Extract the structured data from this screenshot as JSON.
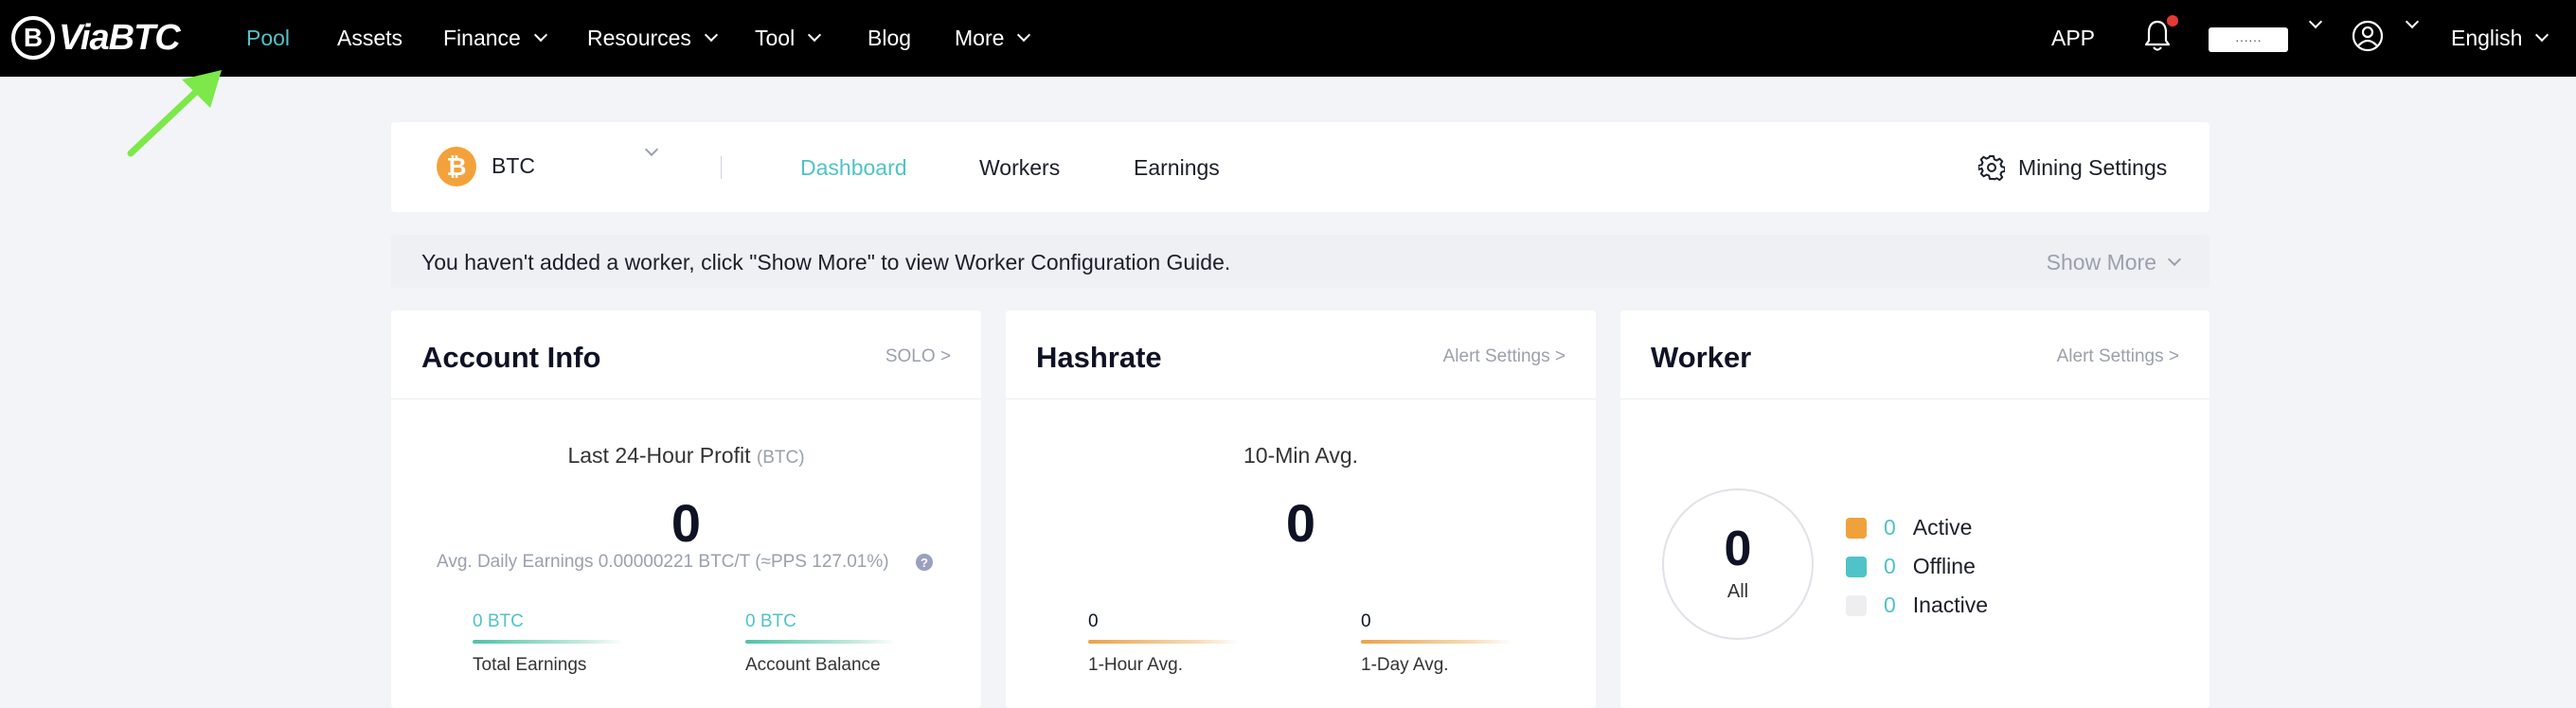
{
  "brand": {
    "name": "ViaBTC",
    "mark": "B"
  },
  "nav": {
    "pool": "Pool",
    "assets": "Assets",
    "finance": "Finance",
    "resources": "Resources",
    "tool": "Tool",
    "blog": "Blog",
    "more": "More",
    "app": "APP",
    "language": "English",
    "username": "······"
  },
  "tabs": {
    "coin": "BTC",
    "coin_symbol": "₿",
    "dashboard": "Dashboard",
    "workers": "Workers",
    "earnings": "Earnings",
    "mining_settings": "Mining Settings"
  },
  "notice": {
    "text": "You haven't added a worker, click \"Show More\" to view Worker Configuration Guide.",
    "show_more": "Show More"
  },
  "account": {
    "title": "Account Info",
    "link": "SOLO >",
    "profit_label": "Last 24-Hour Profit",
    "profit_unit": "(BTC)",
    "profit_value": "0",
    "avg_daily": "Avg. Daily Earnings 0.00000221 BTC/T (≈PPS 127.01%)",
    "help": "?",
    "total_value": "0 BTC",
    "total_label": "Total Earnings",
    "balance_value": "0 BTC",
    "balance_label": "Account Balance"
  },
  "hashrate": {
    "title": "Hashrate",
    "link": "Alert Settings >",
    "avg_label": "10-Min Avg.",
    "avg_value": "0",
    "hour_value": "0",
    "hour_label": "1-Hour Avg.",
    "day_value": "0",
    "day_label": "1-Day Avg."
  },
  "worker": {
    "title": "Worker",
    "link": "Alert Settings >",
    "total": "0",
    "total_label": "All",
    "legend": [
      {
        "count": "0",
        "label": "Active",
        "color": "#f0a13c"
      },
      {
        "count": "0",
        "label": "Offline",
        "color": "#4fc3c6"
      },
      {
        "count": "0",
        "label": "Inactive",
        "color": "#eeeef0"
      }
    ]
  },
  "colors": {
    "accent": "#4fc3c6",
    "nav_bg": "#000000",
    "annotation": "#7de84a"
  }
}
